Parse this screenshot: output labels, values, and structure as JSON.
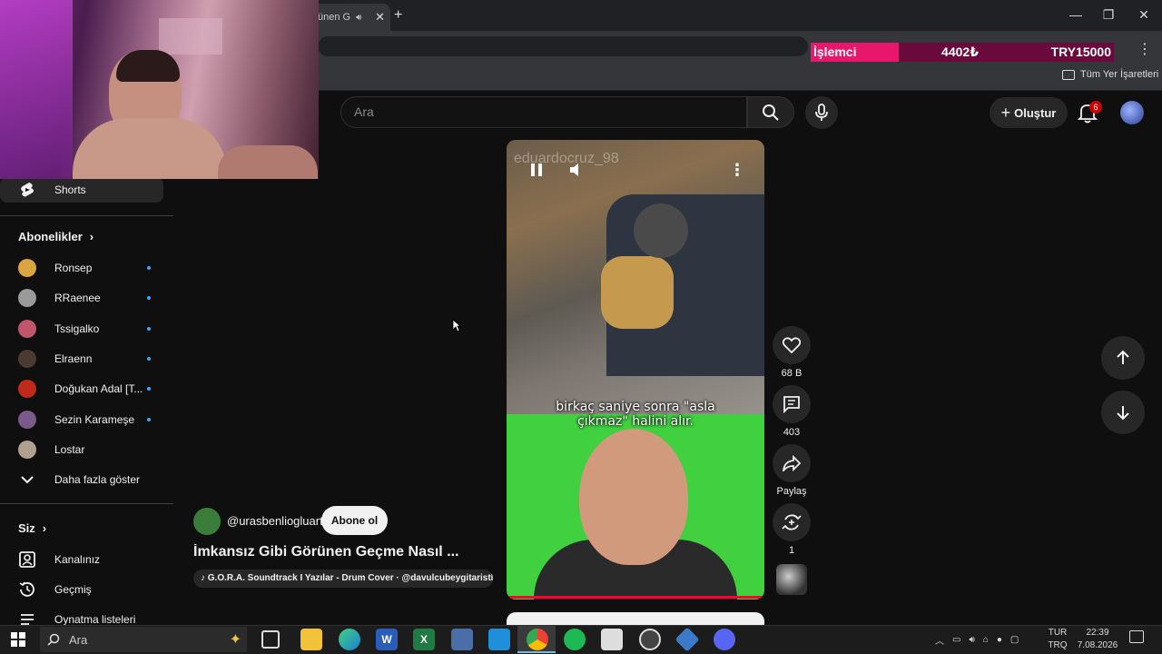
{
  "browser": {
    "tab_title": "ünen G",
    "bookmarks_all": "Tüm Yer İşaretleri"
  },
  "ticker": {
    "label": "İşlemci",
    "value1": "4402₺",
    "value2": "TRY15000"
  },
  "header": {
    "search_placeholder": "Ara",
    "create_label": "Oluştur",
    "notification_count": "6"
  },
  "sidebar": {
    "shorts_label": "Shorts",
    "subscriptions_heading": "Abonelikler",
    "subscriptions": [
      {
        "name": "Ronsep",
        "color": "#d9a441"
      },
      {
        "name": "RRaenee",
        "color": "#9a9a9a"
      },
      {
        "name": "Tssigalko",
        "color": "#c0566a"
      },
      {
        "name": "Elraenn",
        "color": "#4a3a30"
      },
      {
        "name": "Doğukan Adal [T...",
        "color": "#c02a1a"
      },
      {
        "name": "Sezin Karameşe",
        "color": "#7a5a8a"
      },
      {
        "name": "Lostar",
        "color": "#b0a090"
      }
    ],
    "show_more": "Daha fazla göster",
    "you_heading": "Siz",
    "you_items": [
      "Kanalınız",
      "Geçmiş",
      "Oynatma listeleri"
    ]
  },
  "video": {
    "watermark": "eduardocruz_98",
    "subtitle_line1": "birkaç saniye sonra \"asla",
    "subtitle_line2": "çıkmaz\" halini alır.",
    "channel": "@urasbenliogluarti",
    "subscribe_label": "Abone ol",
    "title": "İmkansız Gibi Görünen Geçme Nasıl ...",
    "sound": "G.O.R.A. Soundtrack I Yazılar - Drum Cover · @davulcubeygitaristh..."
  },
  "actions": {
    "likes": "68 B",
    "comments": "403",
    "share": "Paylaş",
    "remix": "1"
  },
  "taskbar": {
    "search_placeholder": "Ara",
    "lang_line1": "TUR",
    "lang_line2": "TRQ",
    "time": "22:39",
    "date": "7.08.2026"
  }
}
